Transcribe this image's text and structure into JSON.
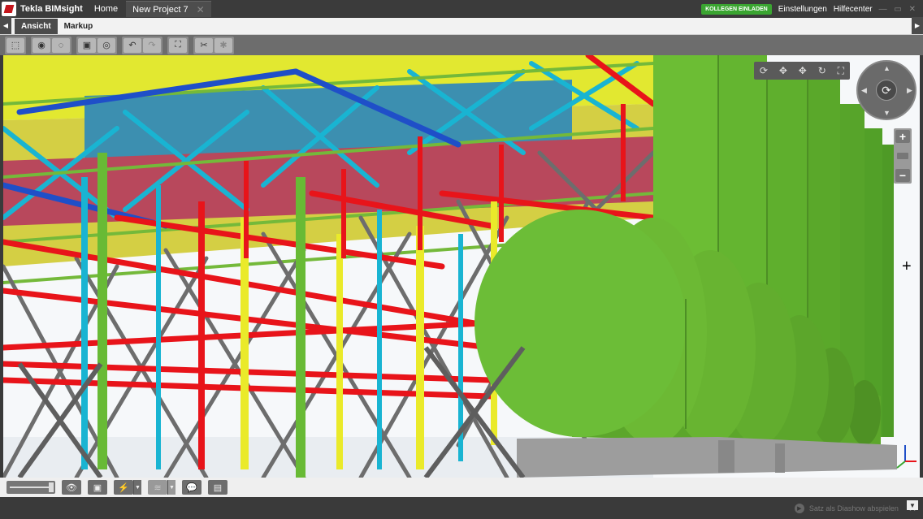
{
  "app": {
    "name": "Tekla BIMsight"
  },
  "titlebar": {
    "home_label": "Home",
    "document_tab": "New Project 7",
    "invite_label": "KOLLEGEN EINLADEN",
    "settings_label": "Einstellungen",
    "help_label": "Hilfecenter"
  },
  "ribbon": {
    "tabs": [
      "Ansicht",
      "Markup"
    ]
  },
  "status": {
    "slideshow_label": "Satz als Diashow abspielen"
  },
  "colors": {
    "invite_green": "#3aa531",
    "steel_red": "#e8141a",
    "steel_yellow": "#eaea2a",
    "steel_cyan": "#19b4d2",
    "steel_green": "#6cc03e",
    "steel_blue": "#1f4fc8",
    "vessel_green": "#68ba35"
  },
  "icons": {
    "toolbar": [
      "select-box-icon",
      "show-icon",
      "hide-icon",
      "snapshot-icon",
      "view-icon",
      "undo-icon",
      "redo-icon",
      "fit-icon",
      "measure-icon",
      "clip-icon"
    ],
    "bottom": [
      "eye-icon",
      "box-icon",
      "lightning-icon",
      "wireframe-icon",
      "comment-icon",
      "document-icon"
    ]
  }
}
